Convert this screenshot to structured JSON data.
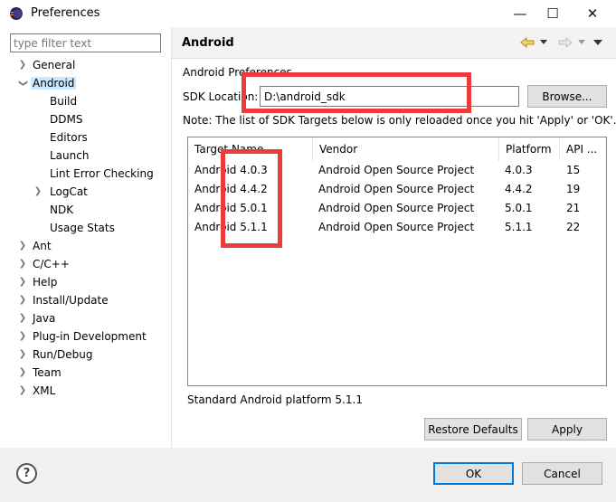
{
  "window": {
    "title": "Preferences",
    "minimize_glyph": "—",
    "maximize_glyph": "☐",
    "close_glyph": "✕"
  },
  "filter": {
    "placeholder": "type filter text",
    "value": ""
  },
  "tree": {
    "items": [
      {
        "label": "General",
        "expanded": false,
        "has_children": true
      },
      {
        "label": "Android",
        "expanded": true,
        "has_children": true,
        "selected": true
      },
      {
        "label": "Build"
      },
      {
        "label": "DDMS"
      },
      {
        "label": "Editors"
      },
      {
        "label": "Launch"
      },
      {
        "label": "Lint Error Checking"
      },
      {
        "label": "LogCat",
        "has_children": true,
        "expanded": false
      },
      {
        "label": "NDK"
      },
      {
        "label": "Usage Stats"
      },
      {
        "label": "Ant",
        "has_children": true
      },
      {
        "label": "C/C++",
        "has_children": true
      },
      {
        "label": "Help",
        "has_children": true
      },
      {
        "label": "Install/Update",
        "has_children": true
      },
      {
        "label": "Java",
        "has_children": true
      },
      {
        "label": "Plug-in Development",
        "has_children": true
      },
      {
        "label": "Run/Debug",
        "has_children": true
      },
      {
        "label": "Team",
        "has_children": true
      },
      {
        "label": "XML",
        "has_children": true
      }
    ]
  },
  "pane": {
    "title": "Android",
    "section_label": "Android Preferences",
    "sdk_label": "SDK Location:",
    "sdk_value": "D:\\android_sdk",
    "browse_label": "Browse...",
    "note": "Note: The list of SDK Targets below is only reloaded once you hit 'Apply' or 'OK'.",
    "table": {
      "headers": [
        "Target Name",
        "Vendor",
        "Platform",
        "API ..."
      ],
      "rows": [
        [
          "Android 4.0.3",
          "Android Open Source Project",
          "4.0.3",
          "15"
        ],
        [
          "Android 4.4.2",
          "Android Open Source Project",
          "4.4.2",
          "19"
        ],
        [
          "Android 5.0.1",
          "Android Open Source Project",
          "5.0.1",
          "21"
        ],
        [
          "Android 5.1.1",
          "Android Open Source Project",
          "5.1.1",
          "22"
        ]
      ]
    },
    "status": "Standard Android platform 5.1.1",
    "restore_label": "Restore Defaults",
    "apply_label": "Apply"
  },
  "footer": {
    "help_glyph": "?",
    "ok_label": "OK",
    "cancel_label": "Cancel"
  },
  "colors": {
    "annotation": "#ed3b3b",
    "selection": "#cce8ff",
    "accent": "#0078d7"
  }
}
